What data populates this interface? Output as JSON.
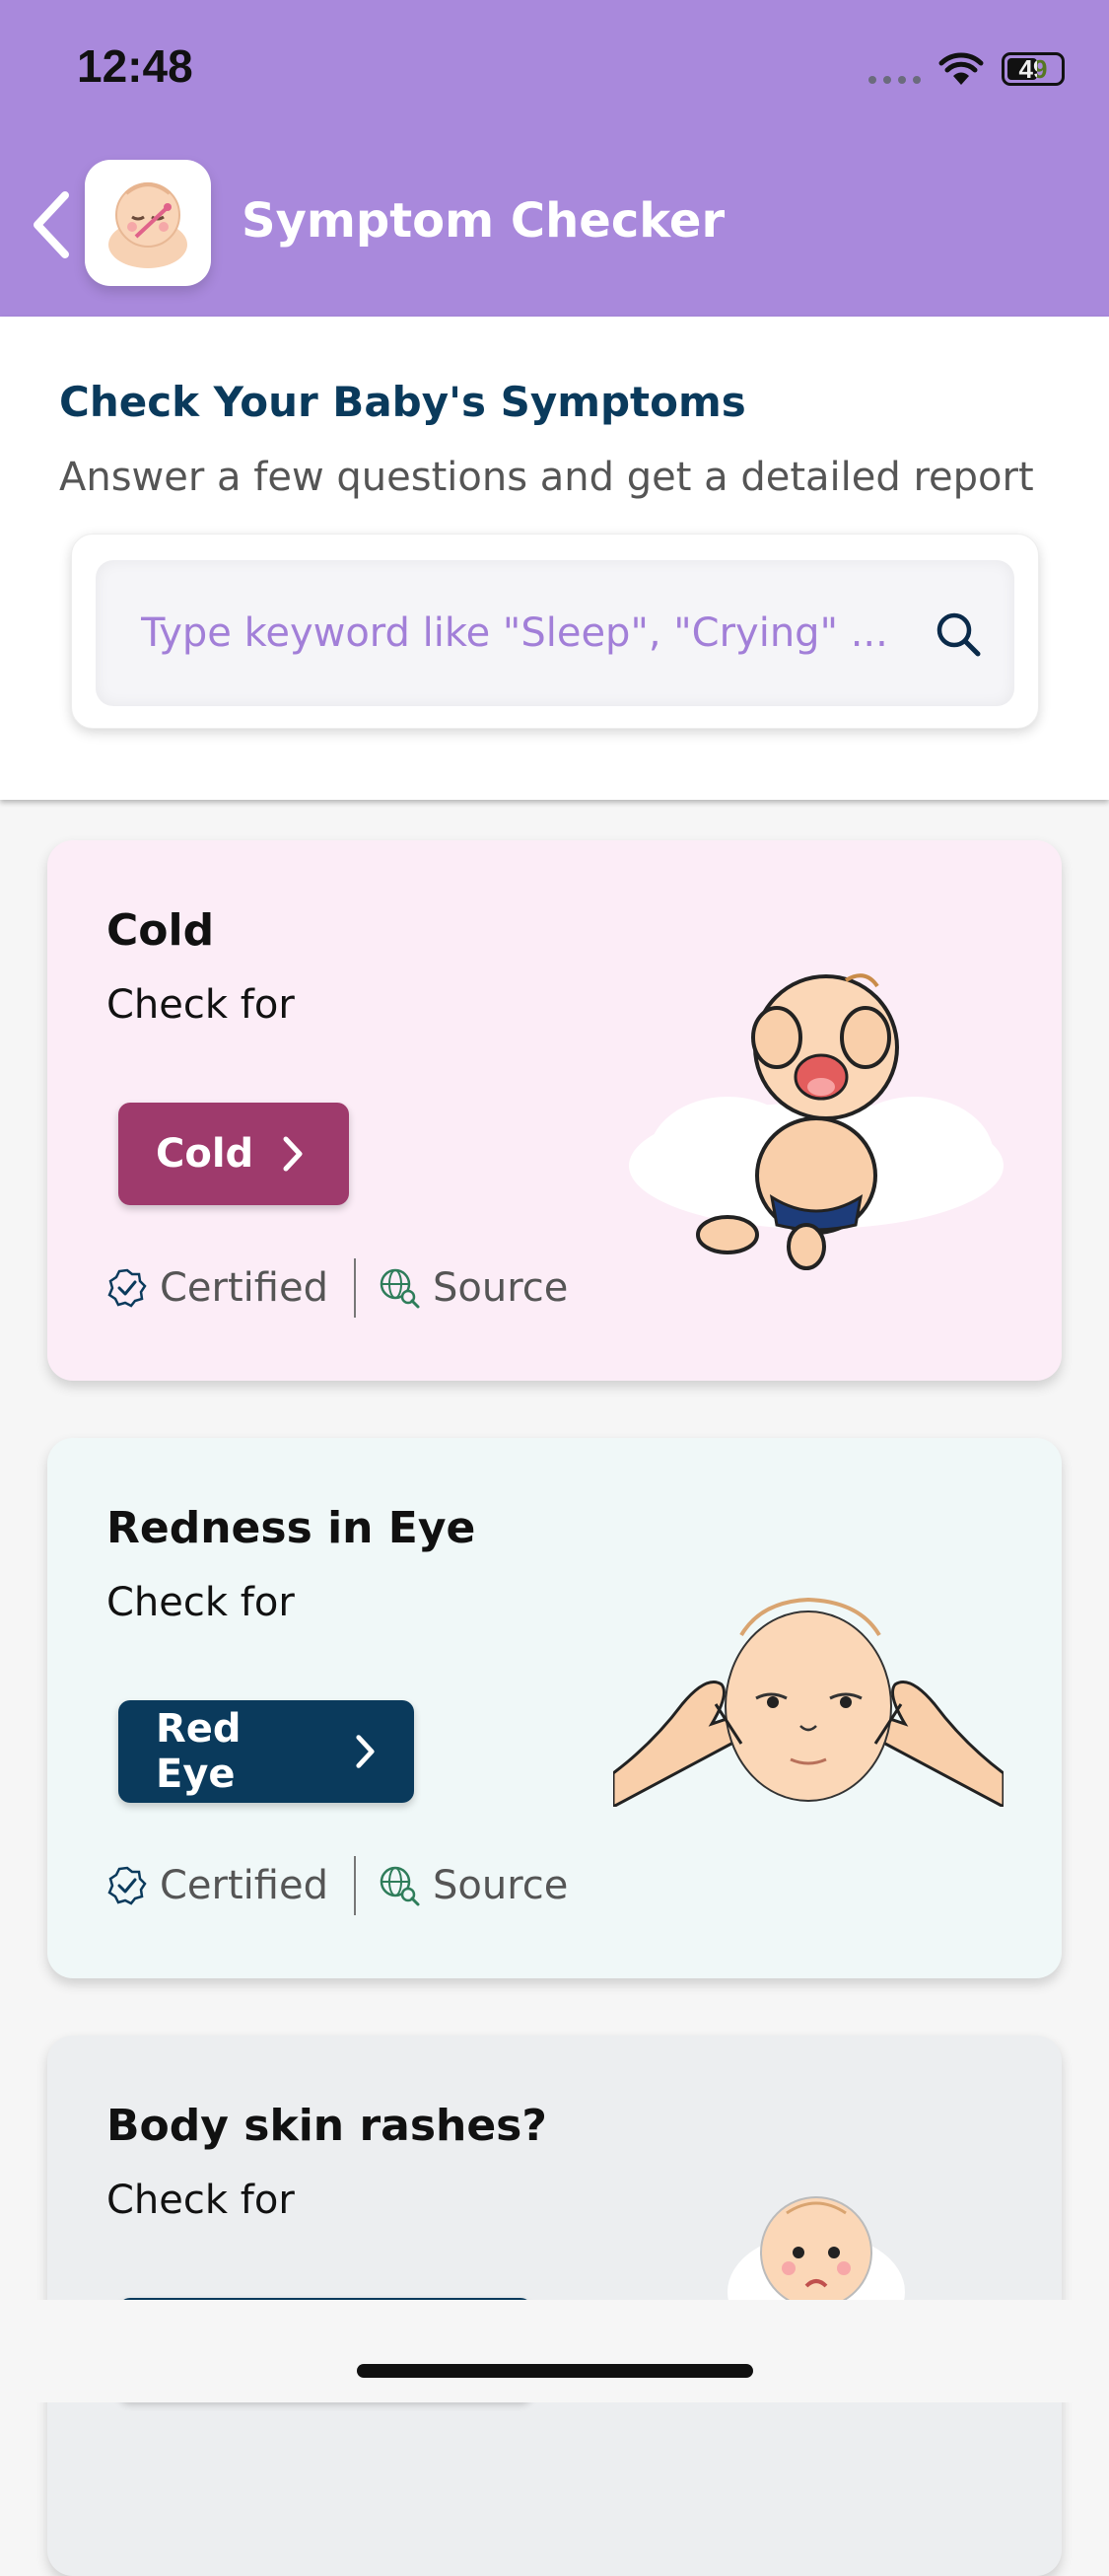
{
  "status_bar": {
    "time": "12:48",
    "battery": "49"
  },
  "header": {
    "title": "Symptom Checker",
    "back_icon": "chevron-left-icon",
    "logo_icon": "sleeping-baby-icon",
    "background": "#a989dc"
  },
  "intro": {
    "title": "Check Your Baby's Symptoms",
    "subtitle": "Answer a few questions and get a detailed report"
  },
  "search": {
    "placeholder": "Type keyword like \"Sleep\", \"Crying\" ...",
    "value": "",
    "icon": "search-icon"
  },
  "cards": [
    {
      "title": "Cold",
      "subtitle": "Check for",
      "button_label": "Cold",
      "certified_label": "Certified",
      "source_label": "Source",
      "background": "#fcedf7",
      "button_color": "#9e3a6c",
      "illustration": "crying-baby-illustration"
    },
    {
      "title": "Redness in Eye",
      "subtitle": "Check for",
      "button_label": "Red Eye",
      "certified_label": "Certified",
      "source_label": "Source",
      "background": "#f0f8f8",
      "button_color": "#0a3a5c",
      "illustration": "baby-eye-rub-illustration"
    },
    {
      "title": "Body skin rashes?",
      "subtitle": "Check for",
      "button_label": "",
      "background": "#eceef0",
      "button_color": "#0a3a5c",
      "illustration": "sad-baby-illustration"
    }
  ]
}
